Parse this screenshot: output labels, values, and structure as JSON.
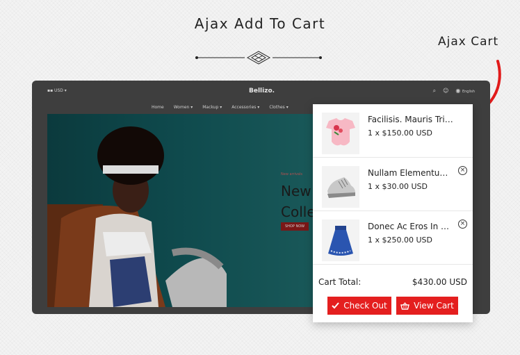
{
  "heading": "Ajax Add To Cart",
  "callout": "Ajax Cart",
  "store": {
    "currency": "USD",
    "logo": "Bellizo.",
    "language": "English",
    "nav": [
      "Home",
      "Women",
      "Mackup",
      "Accessories",
      "Clothes"
    ],
    "hero": {
      "tag": "New arrivals",
      "title_line1": "New",
      "title_line2": "Colle",
      "button": "SHOP NOW"
    }
  },
  "cart": {
    "items": [
      {
        "name": "Facilisis. Mauris Tristi...",
        "qty_price": "1 x $150.00 USD",
        "image": "pink-top"
      },
      {
        "name": "Nullam Elementum ...",
        "qty_price": "1 x $30.00 USD",
        "image": "sneaker"
      },
      {
        "name": "Donec Ac Eros In Dui...",
        "qty_price": "1 x $250.00 USD",
        "image": "blue-skirt"
      }
    ],
    "total_label": "Cart Total:",
    "total_value": "$430.00 USD",
    "checkout_label": "Check Out",
    "view_label": "View Cart"
  },
  "colors": {
    "accent": "#e41f1f",
    "overlay": "#3e3e3e"
  }
}
